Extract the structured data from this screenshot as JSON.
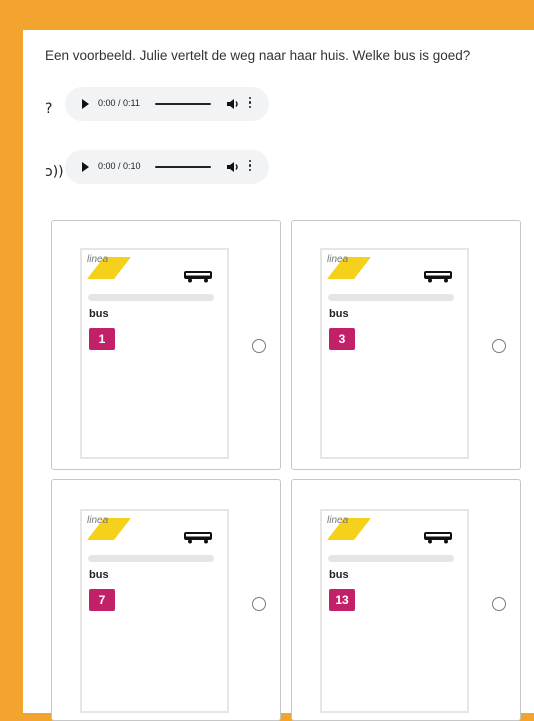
{
  "question": "Een voorbeeld. Julie vertelt de weg naar haar huis. Welke bus is goed?",
  "audio": [
    {
      "icon": "?",
      "time": "0:00 / 0:11"
    },
    {
      "icon": "ↄ))",
      "time": "0:00 / 0:10"
    }
  ],
  "options": [
    {
      "logo": "linea",
      "label": "bus",
      "number": "1"
    },
    {
      "logo": "linea",
      "label": "bus",
      "number": "3"
    },
    {
      "logo": "linea",
      "label": "bus",
      "number": "7"
    },
    {
      "logo": "linea",
      "label": "bus",
      "number": "13"
    }
  ],
  "colors": {
    "frame": "#f2a42e",
    "badge": "#c22169",
    "logo_yellow": "#f6d11c"
  },
  "icons": {
    "audio_1": "question-icon",
    "audio_2": "ear-icon",
    "bus": "bus-icon"
  }
}
